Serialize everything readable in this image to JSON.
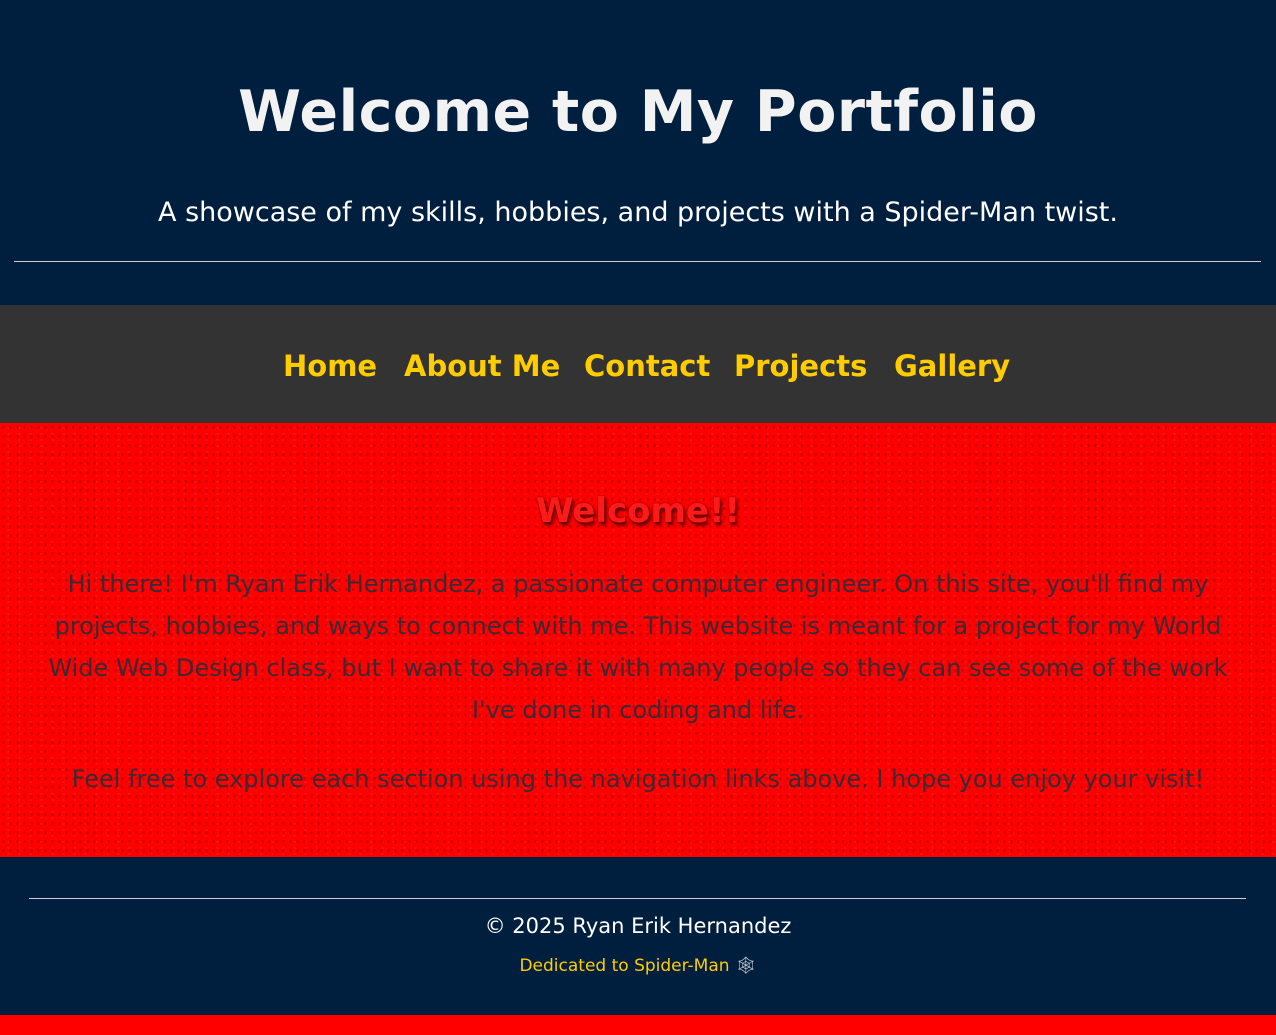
{
  "header": {
    "title": "Welcome to My Portfolio",
    "subtitle": "A showcase of my skills, hobbies, and projects with a Spider-Man twist."
  },
  "nav": {
    "items": [
      {
        "label": "Home"
      },
      {
        "label": "About Me"
      },
      {
        "label": "Contact"
      },
      {
        "label": "Projects"
      },
      {
        "label": "Gallery"
      }
    ]
  },
  "main": {
    "heading": "Welcome!!",
    "paragraphs": [
      "Hi there! I'm Ryan Erik Hernandez, a passionate computer engineer. On this site, you'll find my projects, hobbies, and ways to connect with me. This website is meant for a project for my World Wide Web Design class, but I want to share it with many people so they can see some of the work I've done in coding and life.",
      "Feel free to explore each section using the navigation links above. I hope you enjoy your visit!"
    ]
  },
  "footer": {
    "copyright": "© 2025 Ryan Erik Hernandez",
    "dedication": "Dedicated to Spider-Man",
    "dedication_icon": "spider-web-icon"
  },
  "colors": {
    "header_bg": "#001f3f",
    "nav_bg": "#333333",
    "nav_link": "#ffcc00",
    "main_bg": "#ff0000",
    "body_text": "#3a2a33",
    "footer_accent": "#ffcc00"
  }
}
